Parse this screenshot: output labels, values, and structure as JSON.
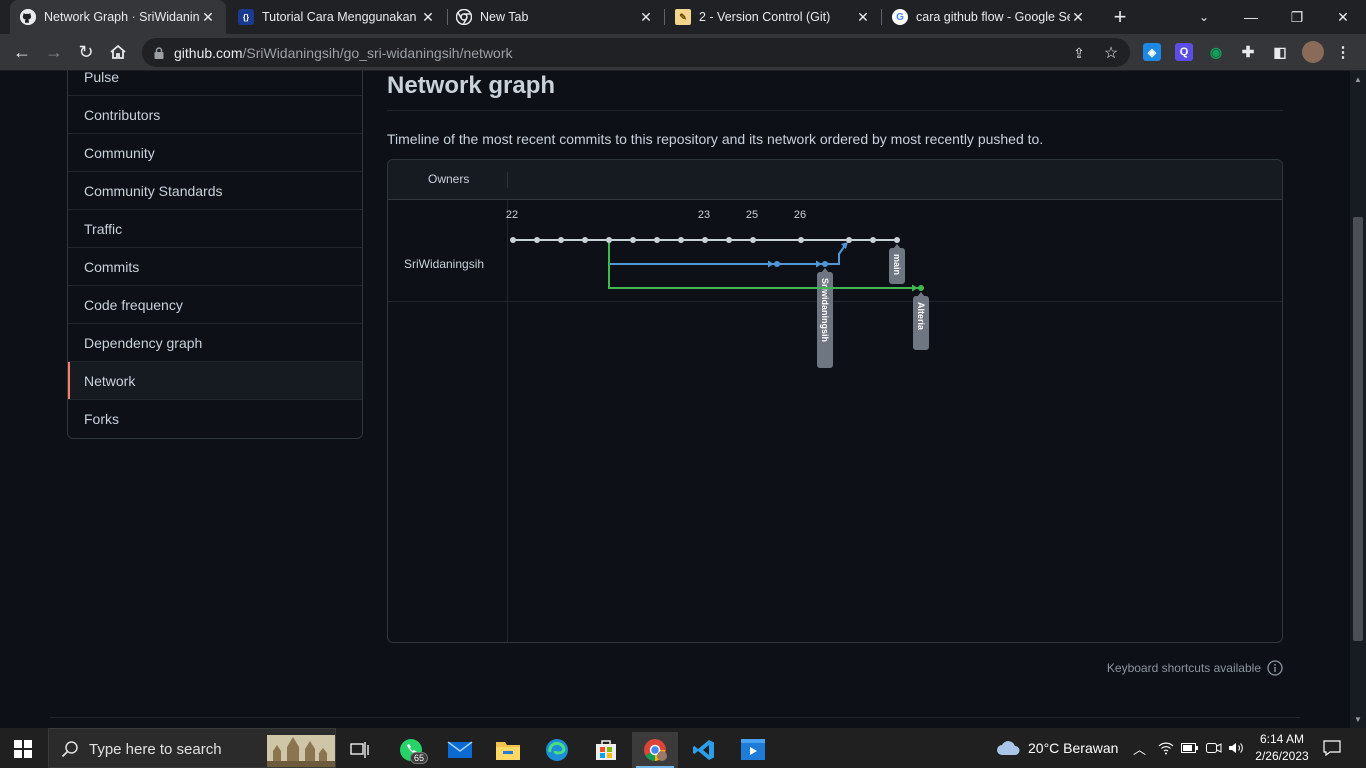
{
  "tabs": [
    {
      "title": "Network Graph · SriWidaning",
      "icon": "github-icon",
      "active": true
    },
    {
      "title": "Tutorial Cara Menggunakan G",
      "icon": "json-icon",
      "active": false
    },
    {
      "title": "New Tab",
      "icon": "chrome-icon",
      "active": false
    },
    {
      "title": "2 - Version Control (Git)",
      "icon": "notepad-icon",
      "active": false
    },
    {
      "title": "cara github flow - Google Se",
      "icon": "google-icon",
      "active": false
    }
  ],
  "address_bar": {
    "domain": "github.com",
    "path": "/SriWidaningsih/go_sri-widaningsih/network"
  },
  "sidebar": {
    "items": [
      {
        "label": "Pulse",
        "selected": false
      },
      {
        "label": "Contributors",
        "selected": false
      },
      {
        "label": "Community",
        "selected": false
      },
      {
        "label": "Community Standards",
        "selected": false
      },
      {
        "label": "Traffic",
        "selected": false
      },
      {
        "label": "Commits",
        "selected": false
      },
      {
        "label": "Code frequency",
        "selected": false
      },
      {
        "label": "Dependency graph",
        "selected": false
      },
      {
        "label": "Network",
        "selected": true
      },
      {
        "label": "Forks",
        "selected": false
      }
    ]
  },
  "main": {
    "title": "Network graph",
    "description": "Timeline of the most recent commits to this repository and its network ordered by most recently pushed to.",
    "owners_header": "Owners",
    "owner": "SriWidaningsih",
    "keyboard_shortcuts": "Keyboard shortcuts available"
  },
  "network": {
    "dates": [
      {
        "label": "22",
        "commit_index": 0
      },
      {
        "label": "23",
        "commit_index": 8
      },
      {
        "label": "25",
        "commit_index": 10
      },
      {
        "label": "26",
        "commit_index": 12
      }
    ],
    "main_commits": 17,
    "branches": [
      {
        "name": "main",
        "lane": 0,
        "color": "#c9d1d9"
      },
      {
        "name": "Sriwidaningsih",
        "lane": 1,
        "color": "#4f97d7",
        "from_commit": 4,
        "commits": [
          11,
          13
        ],
        "merge_into_main_at": 14
      },
      {
        "name": "Alteria",
        "lane": 2,
        "color": "#3fb950",
        "from_commit": 4,
        "commits": [
          17
        ]
      }
    ]
  },
  "taskbar": {
    "search_placeholder": "Type here to search",
    "whatsapp_badge": "65",
    "weather": "20°C  Berawan",
    "time": "6:14 AM",
    "date": "2/26/2023"
  },
  "colors": {
    "accent": "#f78166",
    "bg": "#0d1117",
    "border": "#30363d"
  }
}
